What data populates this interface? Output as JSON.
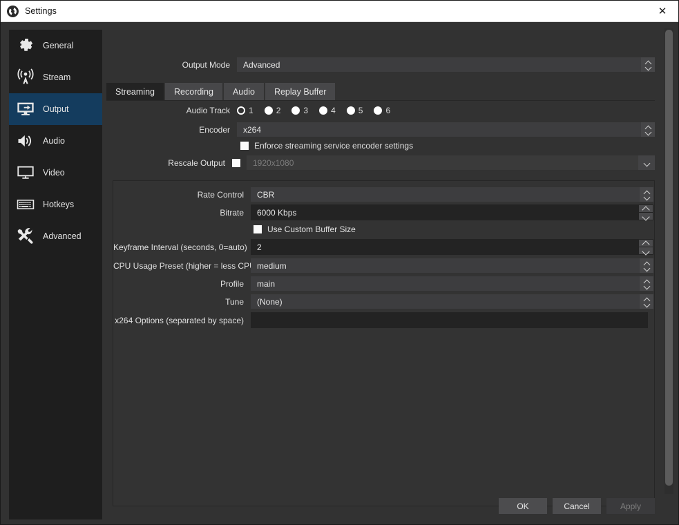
{
  "window": {
    "title": "Settings",
    "app_icon": "obs-logo-icon",
    "close_icon": "close-icon"
  },
  "sidebar": {
    "items": [
      {
        "label": "General",
        "icon": "gear-icon",
        "selected": false
      },
      {
        "label": "Stream",
        "icon": "broadcast-icon",
        "selected": false
      },
      {
        "label": "Output",
        "icon": "monitor-arrow-icon",
        "selected": true
      },
      {
        "label": "Audio",
        "icon": "speaker-icon",
        "selected": false
      },
      {
        "label": "Video",
        "icon": "display-icon",
        "selected": false
      },
      {
        "label": "Hotkeys",
        "icon": "keyboard-icon",
        "selected": false
      },
      {
        "label": "Advanced",
        "icon": "tools-icon",
        "selected": false
      }
    ]
  },
  "output_mode": {
    "label": "Output Mode",
    "value": "Advanced"
  },
  "tabs": [
    {
      "label": "Streaming",
      "active": true
    },
    {
      "label": "Recording",
      "active": false
    },
    {
      "label": "Audio",
      "active": false
    },
    {
      "label": "Replay Buffer",
      "active": false
    }
  ],
  "streaming": {
    "audio_track": {
      "label": "Audio Track",
      "options": [
        "1",
        "2",
        "3",
        "4",
        "5",
        "6"
      ],
      "selected": "1"
    },
    "encoder": {
      "label": "Encoder",
      "value": "x264"
    },
    "enforce": {
      "label": "Enforce streaming service encoder settings",
      "checked": false
    },
    "rescale": {
      "label": "Rescale Output",
      "checked": false,
      "value": "1920x1080",
      "disabled": true
    }
  },
  "encoder_settings": {
    "rate_control": {
      "label": "Rate Control",
      "value": "CBR"
    },
    "bitrate": {
      "label": "Bitrate",
      "value": "6000 Kbps"
    },
    "custom_buffer": {
      "label": "Use Custom Buffer Size",
      "checked": false
    },
    "keyframe": {
      "label": "Keyframe Interval (seconds, 0=auto)",
      "value": "2"
    },
    "cpu_preset": {
      "label": "CPU Usage Preset (higher = less CPU)",
      "value": "medium"
    },
    "profile": {
      "label": "Profile",
      "value": "main"
    },
    "tune": {
      "label": "Tune",
      "value": "(None)"
    },
    "x264_options": {
      "label": "x264 Options (separated by space)",
      "value": ""
    }
  },
  "buttons": {
    "ok": "OK",
    "cancel": "Cancel",
    "apply": "Apply",
    "apply_disabled": true
  },
  "colors": {
    "accent_selected": "#143c5e",
    "panel": "#323232",
    "sidebar": "#1e1e1e",
    "input_dark": "#232323",
    "combo": "#3d3d3f"
  }
}
